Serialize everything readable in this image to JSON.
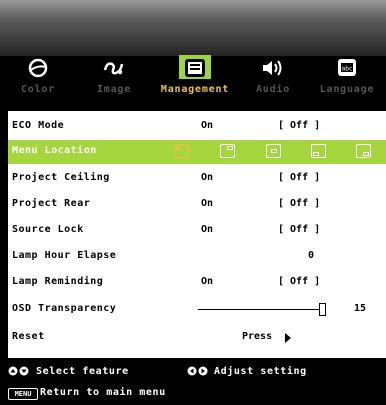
{
  "tabs": [
    {
      "label": "Color",
      "icon": "color-icon",
      "active": false
    },
    {
      "label": "Image",
      "icon": "image-icon",
      "active": false
    },
    {
      "label": "Management",
      "icon": "management-icon",
      "active": true
    },
    {
      "label": "Audio",
      "icon": "audio-icon",
      "active": false
    },
    {
      "label": "Language",
      "icon": "language-icon",
      "active": false
    }
  ],
  "menu": {
    "eco_mode": {
      "label": "ECO Mode",
      "opt_on": "On",
      "opt_off": "[ Off ]"
    },
    "menu_location": {
      "label": "Menu Location",
      "positions": [
        "top-left",
        "top-right",
        "center",
        "bottom-left",
        "bottom-right"
      ],
      "selected": "top-left"
    },
    "project_ceiling": {
      "label": "Project Ceiling",
      "opt_on": "On",
      "opt_off": "[ Off ]"
    },
    "project_rear": {
      "label": "Project Rear",
      "opt_on": "On",
      "opt_off": "[ Off ]"
    },
    "source_lock": {
      "label": "Source Lock",
      "opt_on": "On",
      "opt_off": "[ Off ]"
    },
    "lamp_hour_elapse": {
      "label": "Lamp Hour Elapse",
      "value": "0"
    },
    "lamp_reminding": {
      "label": "Lamp Reminding",
      "opt_on": "On",
      "opt_off": "[ Off ]"
    },
    "osd_transparency": {
      "label": "OSD Transparency",
      "value": "15",
      "level_fraction": 0.97
    },
    "reset": {
      "label": "Reset",
      "action": "Press"
    }
  },
  "help": {
    "select": "Select feature",
    "adjust": "Adjust setting",
    "return": "Return to main menu",
    "menu_key": "MENU"
  },
  "colors": {
    "accent_green": "#a6d63e",
    "active_tab_label": "#f0c24a",
    "panel_bg": "#ffffff"
  }
}
